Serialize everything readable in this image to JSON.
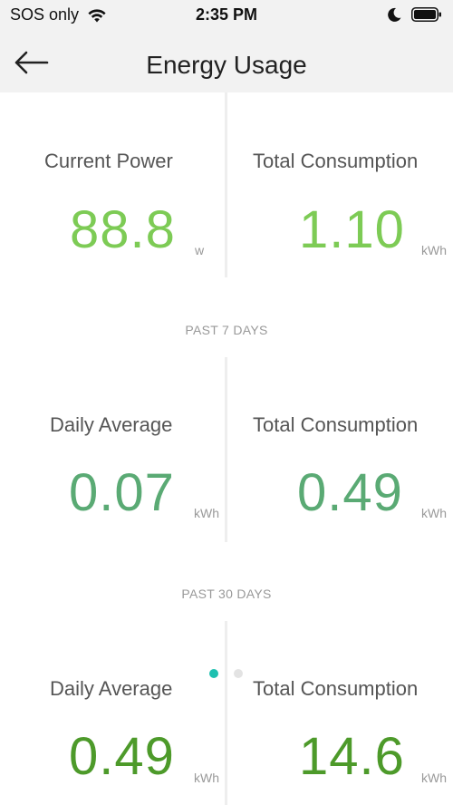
{
  "status_bar": {
    "carrier": "SOS only",
    "time": "2:35 PM"
  },
  "nav": {
    "title": "Energy Usage"
  },
  "now": {
    "left": {
      "label": "Current Power",
      "value": "88.8",
      "unit": "w"
    },
    "right": {
      "label": "Total Consumption",
      "value": "1.10",
      "unit": "kWh"
    }
  },
  "past7": {
    "heading": "PAST 7 DAYS",
    "left": {
      "label": "Daily Average",
      "value": "0.07",
      "unit": "kWh"
    },
    "right": {
      "label": "Total Consumption",
      "value": "0.49",
      "unit": "kWh"
    }
  },
  "past30": {
    "heading": "PAST 30 DAYS",
    "left": {
      "label": "Daily Average",
      "value": "0.49",
      "unit": "kWh"
    },
    "right": {
      "label": "Total Consumption",
      "value": "14.6",
      "unit": "kWh"
    }
  },
  "pager": {
    "count": 2,
    "active": 1
  },
  "colors": {
    "now_value": "#7dcb55",
    "past7_value": "#5aaa74",
    "past30_value": "#4d9a2a",
    "pager_active": "#1ec0b0",
    "pager_inactive": "#e3e3e3"
  }
}
